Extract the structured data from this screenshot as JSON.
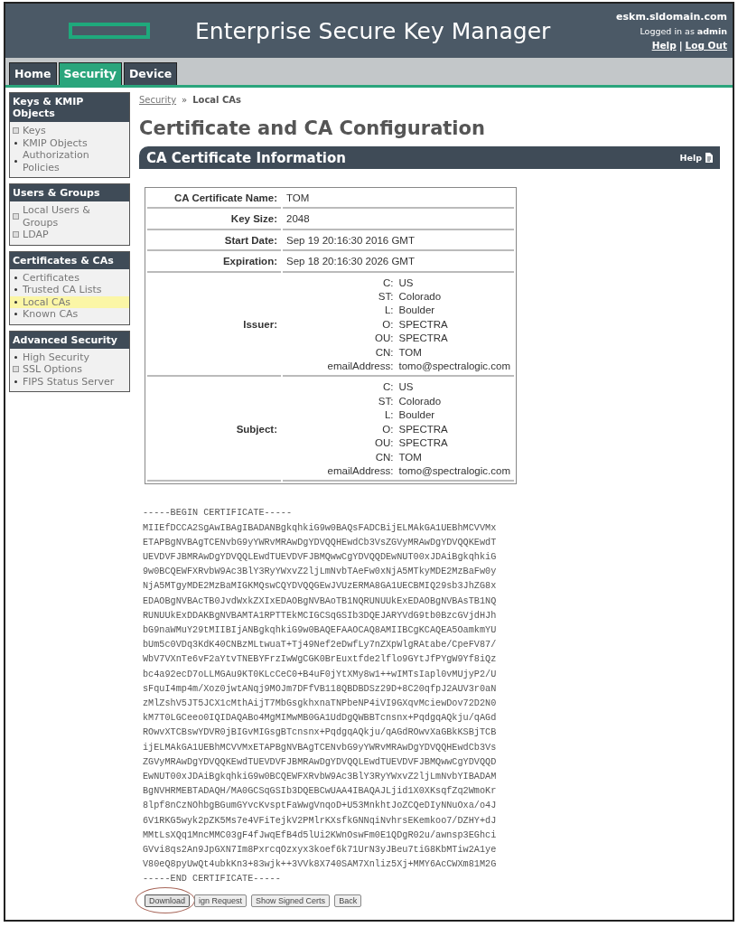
{
  "header": {
    "title": "Enterprise Secure Key Manager",
    "host": "eskm.sldomain.com",
    "login": "Logged in as **admin**",
    "links": [
      "Help",
      "Log Out"
    ],
    "separator": "|"
  },
  "tabs": [
    {
      "label": "Home",
      "selected": false
    },
    {
      "label": "Security",
      "selected": true
    },
    {
      "label": "Device",
      "selected": false
    }
  ],
  "sidebar": [
    {
      "title": "Keys & KMIP Objects",
      "items": [
        {
          "label": "Keys",
          "kind": "expand",
          "selected": false
        },
        {
          "label": "KMIP Objects",
          "kind": "bullet",
          "selected": false
        },
        {
          "label": "Authorization Policies",
          "kind": "bullet",
          "selected": false
        }
      ]
    },
    {
      "title": "Users & Groups",
      "items": [
        {
          "label": "Local Users & Groups",
          "kind": "expand",
          "selected": false
        },
        {
          "label": "LDAP",
          "kind": "expand",
          "selected": false
        }
      ]
    },
    {
      "title": "Certificates & CAs",
      "items": [
        {
          "label": "Certificates",
          "kind": "bullet",
          "selected": false
        },
        {
          "label": "Trusted CA Lists",
          "kind": "bullet",
          "selected": false
        },
        {
          "label": "Local CAs",
          "kind": "bullet",
          "selected": true
        },
        {
          "label": "Known CAs",
          "kind": "bullet",
          "selected": false
        }
      ]
    },
    {
      "title": "Advanced Security",
      "items": [
        {
          "label": "High Security",
          "kind": "bullet",
          "selected": false
        },
        {
          "label": "SSL Options",
          "kind": "expand",
          "selected": false
        },
        {
          "label": "FIPS Status Server",
          "kind": "bullet",
          "selected": false
        }
      ]
    }
  ],
  "breadcrumb": {
    "link": "Security",
    "separator": "»",
    "current": "Local CAs"
  },
  "title": "Certificate and CA Configuration",
  "section": {
    "title": "CA Certificate Information",
    "help": "Help"
  },
  "details": [
    {
      "kind": "simple",
      "label": "CA Certificate Name:",
      "value": "TOM"
    },
    {
      "kind": "simple",
      "label": "Key Size:",
      "value": "2048"
    },
    {
      "kind": "simple",
      "label": "Start Date:",
      "value": "Sep 19 20:16:30 2016 GMT"
    },
    {
      "kind": "simple",
      "label": "Expiration:",
      "value": "Sep 18 20:16:30 2026 GMT"
    },
    {
      "kind": "name",
      "label": "Issuer:",
      "fields": [
        {
          "key": "C:",
          "value": "US"
        },
        {
          "key": "ST:",
          "value": "Colorado"
        },
        {
          "key": "L:",
          "value": "Boulder"
        },
        {
          "key": "O:",
          "value": "SPECTRA"
        },
        {
          "key": "OU:",
          "value": "SPECTRA"
        },
        {
          "key": "CN:",
          "value": "TOM"
        },
        {
          "key": "emailAddress:",
          "value": "tomo@spectralogic.com"
        }
      ]
    },
    {
      "kind": "name",
      "label": "Subject:",
      "fields": [
        {
          "key": "C:",
          "value": "US"
        },
        {
          "key": "ST:",
          "value": "Colorado"
        },
        {
          "key": "L:",
          "value": "Boulder"
        },
        {
          "key": "O:",
          "value": "SPECTRA"
        },
        {
          "key": "OU:",
          "value": "SPECTRA"
        },
        {
          "key": "CN:",
          "value": "TOM"
        },
        {
          "key": "emailAddress:",
          "value": "tomo@spectralogic.com"
        }
      ]
    }
  ],
  "certificate": [
    "-----BEGIN CERTIFICATE-----",
    "MIIEfDCCA2SgAwIBAgIBADANBgkqhkiG9w0BAQsFADCBijELMAkGA1UEBhMCVVMx",
    "ETAPBgNVBAgTCENvbG9yYWRvMRAwDgYDVQQHEwdCb3VsZGVyMRAwDgYDVQQKEwdT",
    "UEVDVFJBMRAwDgYDVQQLEwdTUEVDVFJBMQwwCgYDVQQDEwNUT00xJDAiBgkqhkiG",
    "9w0BCQEWFXRvbW9Ac3BlY3RyYWxvZ2ljLmNvbTAeFw0xNjA5MTkyMDE2MzBaFw0y",
    "NjA5MTgyMDE2MzBaMIGKMQswCQYDVQQGEwJVUzERMA8GA1UECBMIQ29sb3JhZG8x",
    "EDAOBgNVBAcTB0JvdWxkZXIxEDAOBgNVBAoTB1NQRUNUUkExEDAOBgNVBAsTB1NQ",
    "RUNUUkExDDAKBgNVBAMTA1RPTTEkMCIGCSqGSIb3DQEJARYVdG9tb0BzcGVjdHJh",
    "bG9naWMuY29tMIIBIjANBgkqhkiG9w0BAQEFAAOCAQ8AMIIBCgKCAQEA5OamkmYU",
    "bUm5c0VDq3KdK40CNBzMLtwuaT+Tj49Nef2eDwfLy7nZXpWlgRAtabe/CpeFV87/",
    "WbV7VXnTe6vF2aYtvTNEBYFrzIwWgCGK0BrEuxtfde2lflo9GYtJfPYgW9Yf8iQz",
    "bc4a92ecD7oLLMGAu9KT0KLcCeC0+B4uF0jYtXMy8w1++wIMTsIapl0vMUjyP2/U",
    "sFquI4mp4m/Xoz0jwtANqj9MOJm7DFfVB118QBDBDSz29D+8C20qfpJ2AUV3r0aN",
    "zMlZshV5JT5JCX1cMthAijT7MbGsgkhxnaTNPbeNP4iVI9GXqvMciewDov72D2N0",
    "kM7T0LGCeeo0IQIDAQABo4MgMIMwMB0GA1UdDgQWBBTcnsnx+PqdgqAQkju/qAGd",
    "ROwvXTCBswYDVR0jBIGvMIGsgBTcnsnx+PqdgqAQkju/qAGdROwvXaGBkKSBjTCB",
    "ijELMAkGA1UEBhMCVVMxETAPBgNVBAgTCENvbG9yYWRvMRAwDgYDVQQHEwdCb3Vs",
    "ZGVyMRAwDgYDVQQKEwdTUEVDVFJBMRAwDgYDVQQLEwdTUEVDVFJBMQwwCgYDVQQD",
    "EwNUT00xJDAiBgkqhkiG9w0BCQEWFXRvbW9Ac3BlY3RyYWxvZ2ljLmNvbYIBADAM",
    "BgNVHRMEBTADAQH/MA0GCSqGSIb3DQEBCwUAA4IBAQAJLjid1X0XKsqfZq2WmoKr",
    "8lpf8nCzNOhbgBGumGYvcKvsptFaWwgVnqoD+U53MnkhtJoZCQeDIyNNuOxa/o4J",
    "6V1RKG5wyk2pZK5Ms7e4VFiTejkV2PMlrKXsfkGNNqiNvhrsEKemkoo7/DZHY+dJ",
    "MMtLsXQq1MncMMC03gF4fJwqEfB4d5lUi2KWnOswFm0E1QDgR02u/awnsp3EGhci",
    "GVvi8qs2An9JpGXN7Im8PxrcqOzxyx3koef6k71UrN3yJBeu7tiG8KbMTiw2A1ye",
    "V80eQ8pyUwQt4ubkKn3+83wjk++3VVk8X740SAM7Xnliz5Xj+MMY6AcCWXm81M2G",
    "-----END CERTIFICATE-----"
  ],
  "buttons": [
    {
      "label": "Download",
      "highlighted": true
    },
    {
      "label": "ign Request",
      "highlighted": false
    },
    {
      "label": "Show Signed Certs",
      "highlighted": false
    },
    {
      "label": "Back",
      "highlighted": false
    }
  ]
}
